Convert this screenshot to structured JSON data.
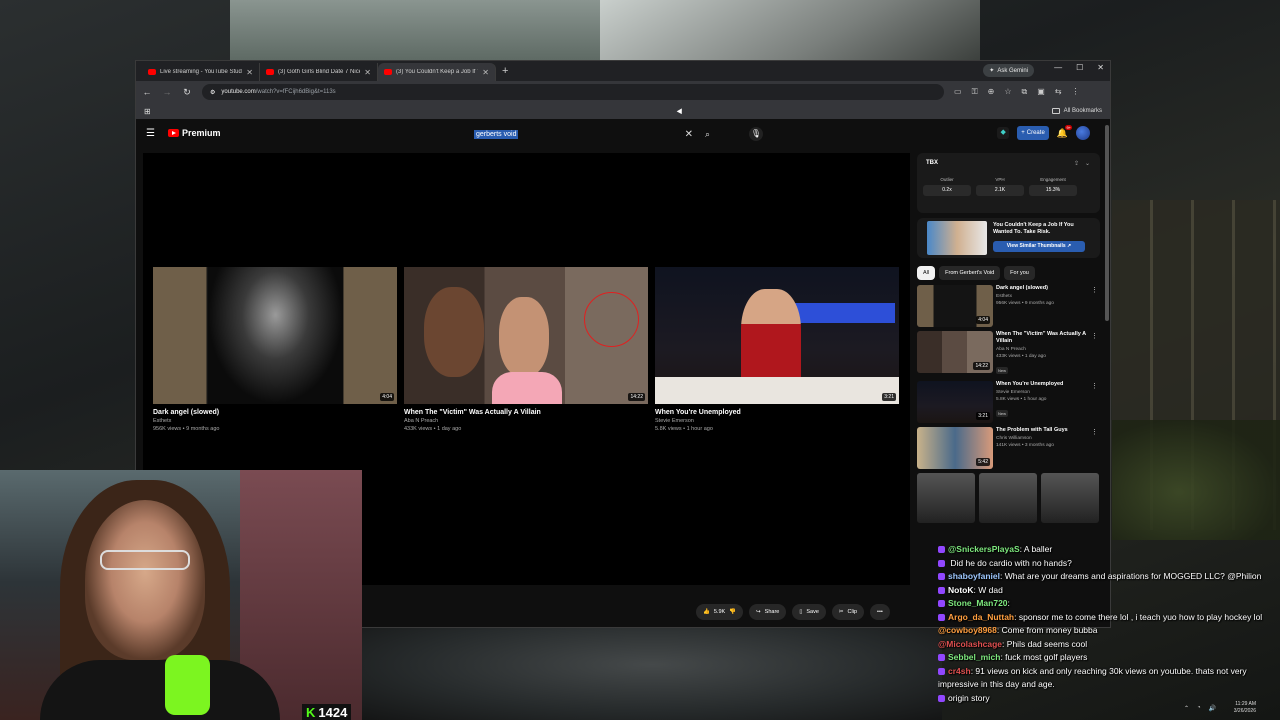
{
  "browser": {
    "tabs": [
      {
        "title": "Live streaming - YouTube Studi",
        "active": false
      },
      {
        "title": "(3) Goth Girls Blind Date 7 Nice",
        "active": false
      },
      {
        "title": "(3) You Couldn't Keep a Job If Y",
        "active": true
      }
    ],
    "new_tab": "+",
    "gemini_label": "Ask Gemini",
    "url_host": "youtube.com",
    "url_path": "/watch?v=fFCijh6dBig&t=113s",
    "bookmarks_all": "All Bookmarks"
  },
  "youtube": {
    "logo_text": "Premium",
    "search_query": "gerberts void",
    "create_label": "Create",
    "notif_count": "9+",
    "end_screen": [
      {
        "title": "Dark angel (slowed)",
        "channel": "Esthetx",
        "meta": "956K views • 9 months ago",
        "duration": "4:04"
      },
      {
        "title": "When The \"Victim\" Was Actually A Villain",
        "channel": "Aba N Preach",
        "meta": "433K views • 1 day ago",
        "duration": "14:22"
      },
      {
        "title": "When You're Unemployed",
        "channel": "Stevie Emerson",
        "meta": "5.8K views • 1 hour ago",
        "duration": "3:21"
      }
    ],
    "actions": {
      "likes": "5.9K",
      "share": "Share",
      "save": "Save",
      "clip": "Clip",
      "more": "•••"
    }
  },
  "sidebar": {
    "tool_badge": "TBX",
    "stats": [
      {
        "label": "Outlier",
        "value": "0.2x"
      },
      {
        "label": "VPH",
        "value": "2.1K"
      },
      {
        "label": "Engagement",
        "value": "15.3%"
      }
    ],
    "suggest_title": "You Couldn't Keep a Job If You Wanted To. Take Risk.",
    "suggest_button": "View Similar Thumbnails ↗",
    "chips": [
      "All",
      "From Gerbert's Void",
      "For you"
    ],
    "related": [
      {
        "title": "Dark angel (slowed)",
        "channel": "Esthetx",
        "meta": "956K views • 9 months ago",
        "duration": "4:04",
        "is_new": false
      },
      {
        "title": "When The \"Victim\" Was Actually A Villain",
        "channel": "Aba N Preach",
        "meta": "433K views • 1 day ago",
        "duration": "14:22",
        "is_new": true
      },
      {
        "title": "When You're Unemployed",
        "channel": "Stevie Emerson",
        "meta": "5.8K views • 1 hour ago",
        "duration": "3:21",
        "is_new": true
      },
      {
        "title": "The Problem with Tall Guys",
        "channel": "Chris Williamson",
        "meta": "141K views • 3 months ago",
        "duration": "5:42",
        "is_new": false
      }
    ],
    "new_label": "New"
  },
  "stream": {
    "viewer_count": "1424",
    "chat": [
      {
        "user": "@SnickersPlayaS",
        "text": "A baller",
        "color": "#7ee87e"
      },
      {
        "user": "",
        "text": "Did he do cardio with no hands?",
        "color": "#e05050"
      },
      {
        "user": "shaboyfaniel",
        "text": "What are your dreams and aspirations for MOGGED LLC? @Philion",
        "color": "#9ec8ff"
      },
      {
        "user": "NotoK",
        "text": "W dad",
        "color": "#ffffff"
      },
      {
        "user": "Stone_Man720",
        "text": "",
        "color": "#7ee87e"
      },
      {
        "user": "Argo_da_Nuttah",
        "text": "sponsor me to come there lol , i teach yuo how to play hockey lol",
        "color": "#ff9f40"
      },
      {
        "user": "@cowboy8968",
        "text": "Come from money bubba",
        "color": "#ff9f40"
      },
      {
        "user": "@Micolashcage",
        "text": "Phils dad seems cool",
        "color": "#e05050"
      },
      {
        "user": "Sebbel_mich",
        "text": "fuck most golf players",
        "color": "#7ee87e"
      },
      {
        "user": "cr4sh",
        "text": "91 views on kick and only reaching 30k views on youtube. thats not very",
        "color": "#e05050"
      },
      {
        "user": "",
        "text": "impressive in this day and age.",
        "color": "#ffffff"
      },
      {
        "user": "",
        "text": "origin story",
        "color": "#ffffff"
      }
    ],
    "clock_time": "11:29 AM",
    "clock_date": "3/26/2026"
  }
}
